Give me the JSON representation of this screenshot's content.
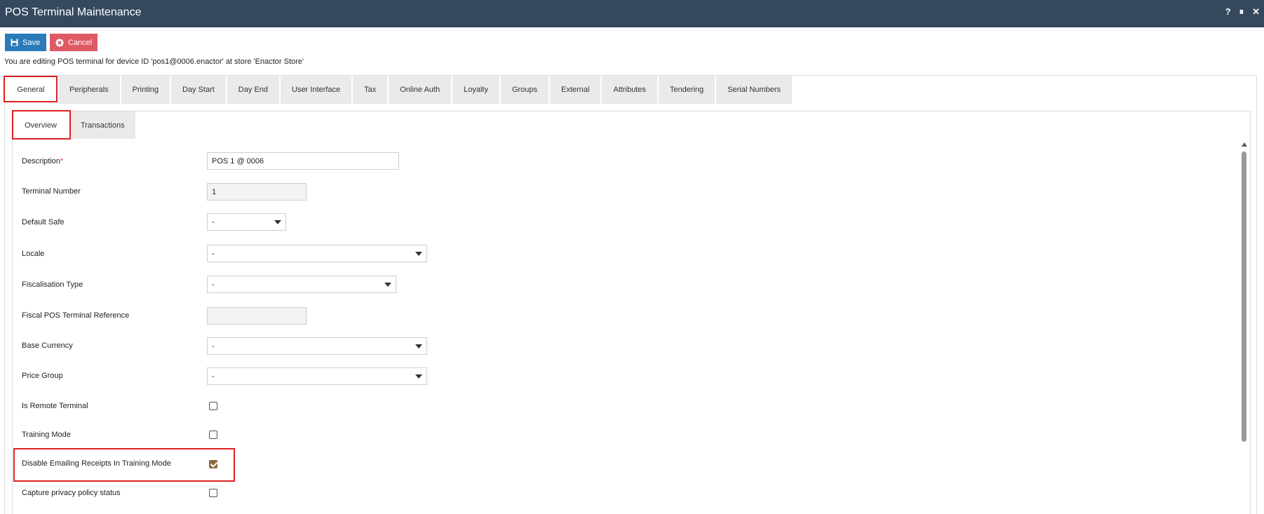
{
  "window": {
    "title": "POS Terminal Maintenance",
    "controls": [
      "?",
      "⏸",
      "✕"
    ]
  },
  "toolbar": {
    "save_label": "Save",
    "cancel_label": "Cancel"
  },
  "edit_message": "You are editing POS terminal for device ID 'pos1@0006.enactor' at store 'Enactor Store'",
  "main_tabs": [
    {
      "label": "General",
      "active": true
    },
    {
      "label": "Peripherals"
    },
    {
      "label": "Printing"
    },
    {
      "label": "Day Start"
    },
    {
      "label": "Day End"
    },
    {
      "label": "User Interface"
    },
    {
      "label": "Tax"
    },
    {
      "label": "Online Auth"
    },
    {
      "label": "Loyalty"
    },
    {
      "label": "Groups"
    },
    {
      "label": "External"
    },
    {
      "label": "Attributes"
    },
    {
      "label": "Tendering"
    },
    {
      "label": "Serial Numbers"
    }
  ],
  "sub_tabs": [
    {
      "label": "Overview",
      "active": true
    },
    {
      "label": "Transactions"
    }
  ],
  "form": {
    "description": {
      "label": "Description",
      "required_mark": "*",
      "value": "POS 1 @ 0006"
    },
    "terminal_number": {
      "label": "Terminal Number",
      "value": "1"
    },
    "default_safe": {
      "label": "Default Safe",
      "value": "-"
    },
    "locale": {
      "label": "Locale",
      "value": "-"
    },
    "fiscalisation_type": {
      "label": "Fiscalisation Type",
      "value": "-"
    },
    "fiscal_pos_ref": {
      "label": "Fiscal POS Terminal Reference",
      "value": ""
    },
    "base_currency": {
      "label": "Base Currency",
      "value": "-"
    },
    "price_group": {
      "label": "Price Group",
      "value": "-"
    },
    "is_remote_terminal": {
      "label": "Is Remote Terminal",
      "checked": false
    },
    "training_mode": {
      "label": "Training Mode",
      "checked": false
    },
    "disable_emailing": {
      "label": "Disable Emailing Receipts In Training Mode",
      "checked": true
    },
    "capture_privacy": {
      "label": "Capture privacy policy status",
      "checked": false
    }
  },
  "colors": {
    "titlebar": "#34495e",
    "save": "#2a7bb8",
    "cancel": "#e05a66",
    "highlight": "#e02020",
    "checked": "#8a6a3c"
  }
}
